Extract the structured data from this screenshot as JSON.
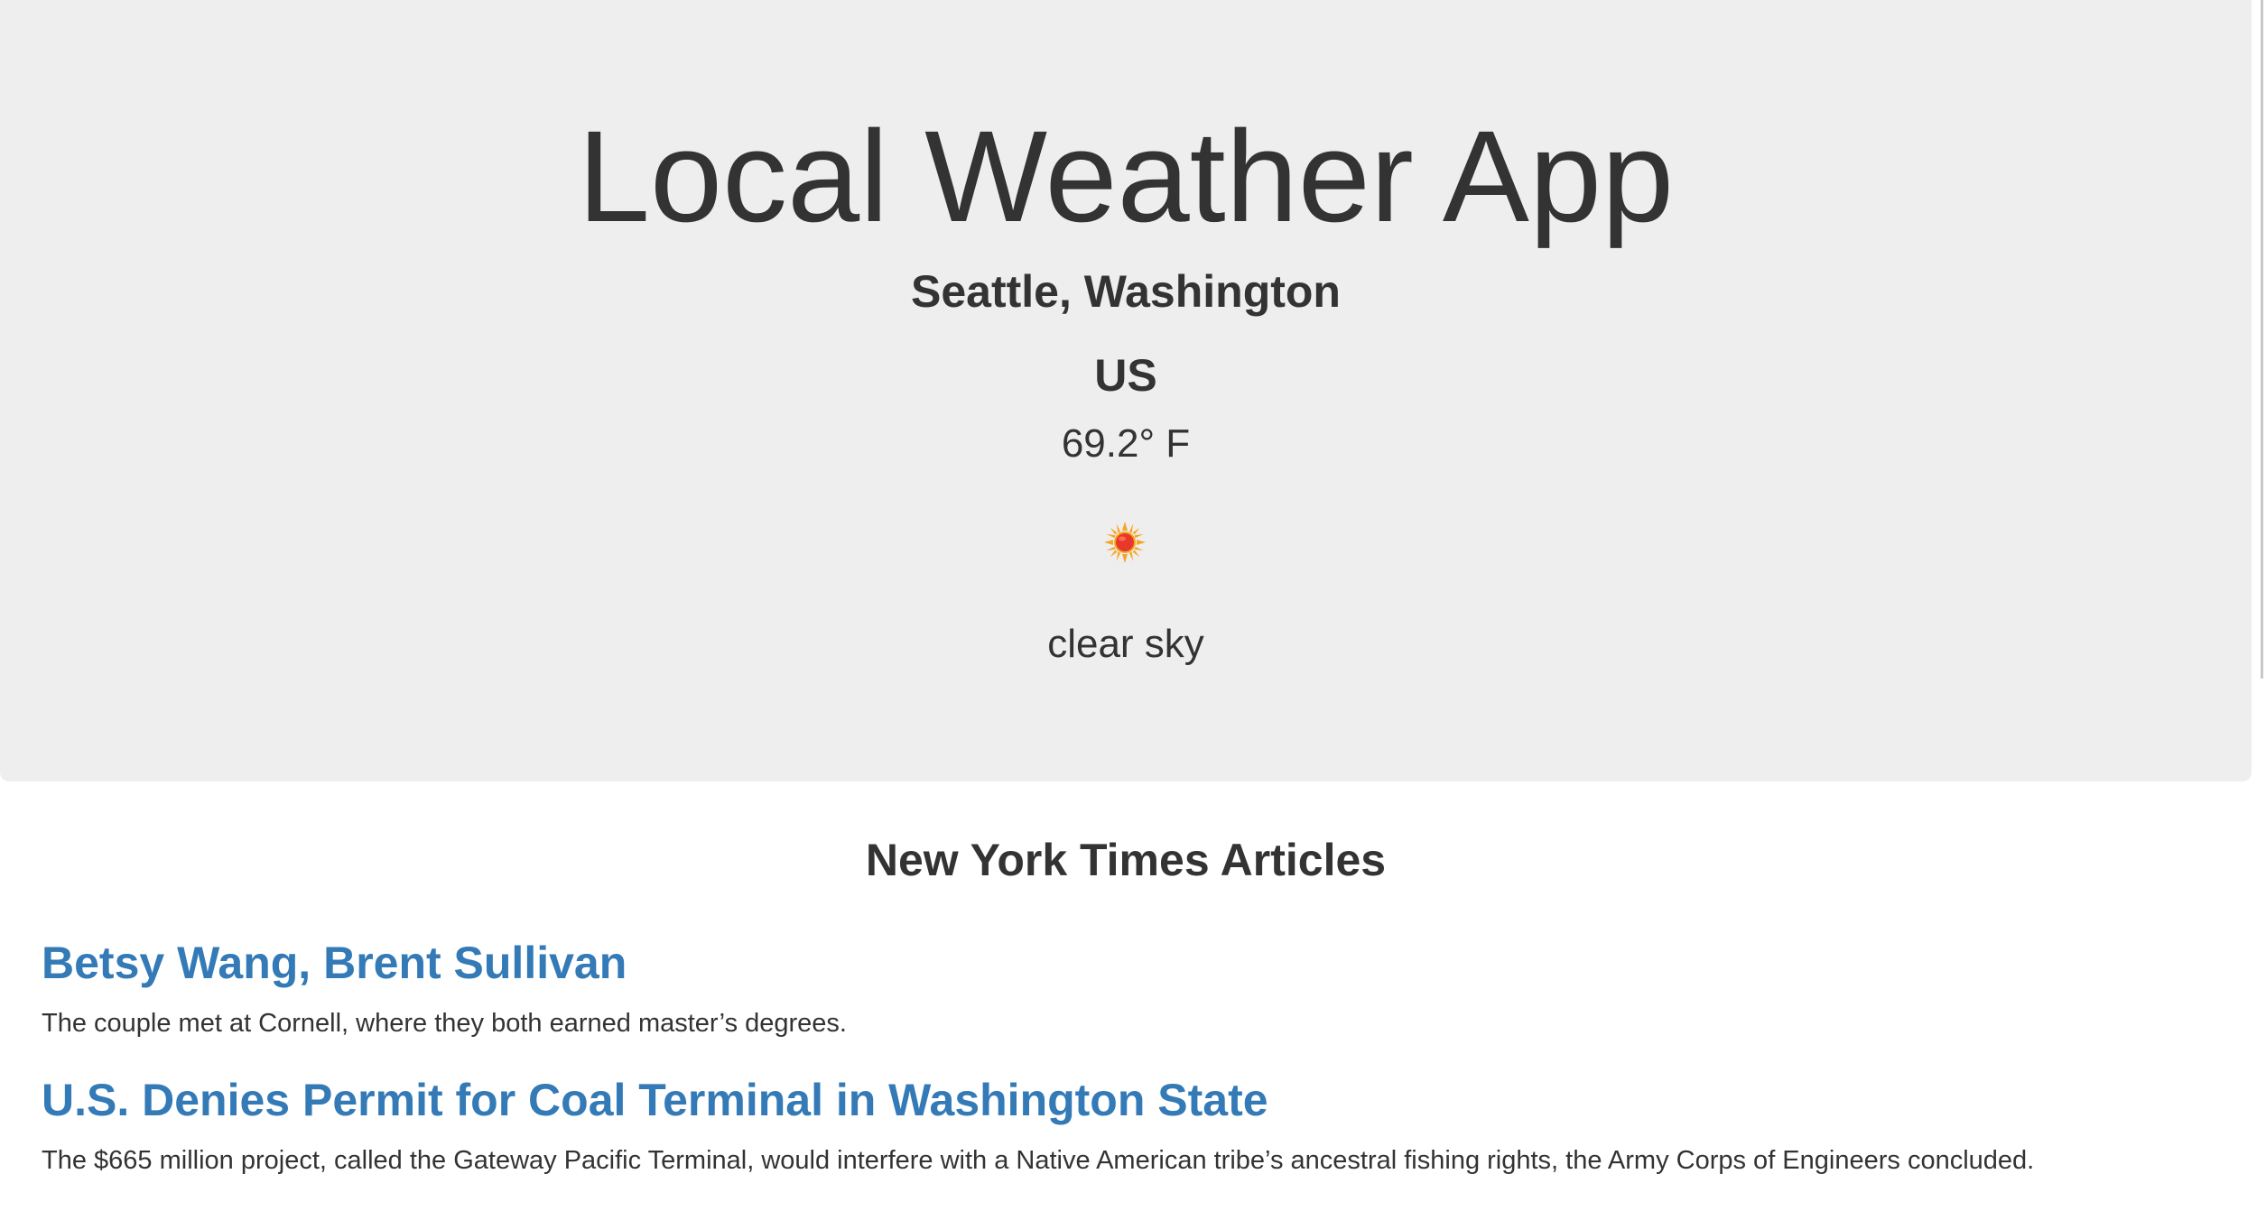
{
  "app": {
    "title": "Local Weather App"
  },
  "weather": {
    "city": "Seattle, Washington",
    "country": "US",
    "temperature": "69.2° F",
    "icon": "sun-icon",
    "condition": "clear sky"
  },
  "articles": {
    "heading": "New York Times Articles",
    "items": [
      {
        "title": "Betsy Wang, Brent Sullivan",
        "snippet": "The couple met at Cornell, where they both earned master’s degrees."
      },
      {
        "title": "U.S. Denies Permit for Coal Terminal in Washington State",
        "snippet": "The $665 million project, called the Gateway Pacific Terminal, would interfere with a Native American tribe’s ancestral fishing rights, the Army Corps of Engineers concluded."
      }
    ]
  },
  "colors": {
    "jumbotron_bg": "#eeeeee",
    "text": "#333333",
    "link": "#337ab7",
    "sun_core": "#e8382a",
    "sun_rays": "#f5a623"
  }
}
